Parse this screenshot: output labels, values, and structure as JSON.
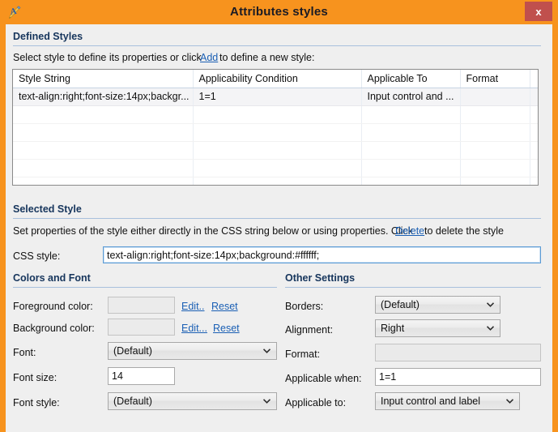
{
  "window": {
    "title": "Attributes styles",
    "icon": "attributes-styles-icon",
    "close_label": "x",
    "accent_color": "#f7931e",
    "close_color": "#c0504d"
  },
  "defined_styles": {
    "heading": "Defined Styles",
    "instruction_before": "Select style to define its properties or click",
    "add_link": "Add",
    "instruction_after": "to define a new style:",
    "table": {
      "columns": [
        "Style String",
        "Applicability Condition",
        "Applicable To",
        "Format",
        ""
      ],
      "rows": [
        {
          "style_string": "text-align:right;font-size:14px;backgr...",
          "applicability_condition": "1=1",
          "applicable_to": "Input control and ...",
          "format": "",
          "extra": "",
          "selected": true
        }
      ],
      "empty_row_count": 5
    }
  },
  "selected_style": {
    "heading": "Selected Style",
    "instruction_before": "Set properties of the style either directly in the CSS string below or using properties. Click",
    "delete_link": "Delete",
    "instruction_after": "to delete the style",
    "css_label": "CSS style:",
    "css_value": "text-align:right;font-size:14px;background:#ffffff;"
  },
  "colors_and_font": {
    "heading": "Colors and Font",
    "foreground_label": "Foreground color:",
    "foreground_value": "",
    "foreground_edit": "Edit..",
    "foreground_reset": "Reset",
    "background_label": "Background color:",
    "background_value": "",
    "background_edit": "Edit...",
    "background_reset": "Reset",
    "font_label": "Font:",
    "font_value": "(Default)",
    "font_size_label": "Font size:",
    "font_size_value": "14",
    "font_style_label": "Font style:",
    "font_style_value": "(Default)"
  },
  "other_settings": {
    "heading": "Other Settings",
    "borders_label": "Borders:",
    "borders_value": "(Default)",
    "alignment_label": "Alignment:",
    "alignment_value": "Right",
    "format_label": "Format:",
    "format_value": "",
    "applicable_when_label": "Applicable when:",
    "applicable_when_value": "1=1",
    "applicable_to_label": "Applicable to:",
    "applicable_to_value": "Input control and label"
  }
}
